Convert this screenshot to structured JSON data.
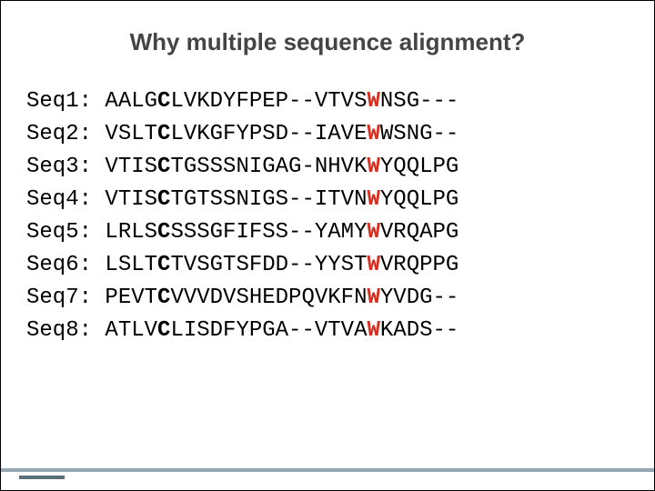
{
  "title": "Why multiple sequence alignment?",
  "sequences": [
    {
      "label": "Seq1: ",
      "segments": [
        {
          "t": "AALG",
          "c": "res"
        },
        {
          "t": "C",
          "c": "bold"
        },
        {
          "t": "LVKDYFPEP--VTVS",
          "c": "res"
        },
        {
          "t": "W",
          "c": "red"
        },
        {
          "t": "NSG---",
          "c": "res"
        }
      ]
    },
    {
      "label": "Seq2: ",
      "segments": [
        {
          "t": "VSLT",
          "c": "res"
        },
        {
          "t": "C",
          "c": "bold"
        },
        {
          "t": "LVKGFYPSD--IAVE",
          "c": "res"
        },
        {
          "t": "W",
          "c": "red"
        },
        {
          "t": "WSNG--",
          "c": "res"
        }
      ]
    },
    {
      "label": "Seq3: ",
      "segments": [
        {
          "t": "VTIS",
          "c": "res"
        },
        {
          "t": "C",
          "c": "bold"
        },
        {
          "t": "TGSSSNIGAG-NHVK",
          "c": "res"
        },
        {
          "t": "W",
          "c": "red"
        },
        {
          "t": "YQQLPG",
          "c": "res"
        }
      ]
    },
    {
      "label": "Seq4: ",
      "segments": [
        {
          "t": "VTIS",
          "c": "res"
        },
        {
          "t": "C",
          "c": "bold"
        },
        {
          "t": "TGTSSNIGS--ITVN",
          "c": "res"
        },
        {
          "t": "W",
          "c": "red"
        },
        {
          "t": "YQQLPG",
          "c": "res"
        }
      ]
    },
    {
      "label": "Seq5: ",
      "segments": [
        {
          "t": "LRLS",
          "c": "res"
        },
        {
          "t": "C",
          "c": "bold"
        },
        {
          "t": "SSSGFIFSS--YAMY",
          "c": "res"
        },
        {
          "t": "W",
          "c": "red"
        },
        {
          "t": "VRQAPG",
          "c": "res"
        }
      ]
    },
    {
      "label": "Seq6: ",
      "segments": [
        {
          "t": "LSLT",
          "c": "res"
        },
        {
          "t": "C",
          "c": "bold"
        },
        {
          "t": "TVSGTSFDD--YYST",
          "c": "res"
        },
        {
          "t": "W",
          "c": "red"
        },
        {
          "t": "VRQPPG",
          "c": "res"
        }
      ]
    },
    {
      "label": "Seq7: ",
      "segments": [
        {
          "t": "PEVT",
          "c": "res"
        },
        {
          "t": "C",
          "c": "bold"
        },
        {
          "t": "VVVDVSHEDPQVKFN",
          "c": "res"
        },
        {
          "t": "W",
          "c": "red"
        },
        {
          "t": "YVDG--",
          "c": "res"
        }
      ]
    },
    {
      "label": "Seq8: ",
      "segments": [
        {
          "t": "ATLV",
          "c": "res"
        },
        {
          "t": "C",
          "c": "bold"
        },
        {
          "t": "LISDFYPGA--VTVA",
          "c": "res"
        },
        {
          "t": "W",
          "c": "red"
        },
        {
          "t": "KADS--",
          "c": "res"
        }
      ]
    }
  ]
}
